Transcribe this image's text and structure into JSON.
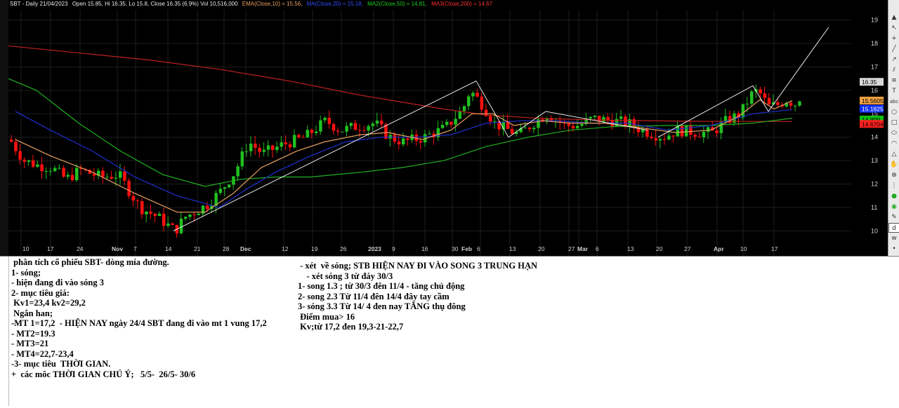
{
  "chart": {
    "symbol": "SBT - Daily 21/04/2023",
    "ohlc": "Open 15.85, Hi 16.35, Lo 15.8, Close 16.35 (6.9%) Vol 10,516,000",
    "indicators": [
      {
        "label": "EMA(Close,10) = 15.56,",
        "color": "#e8a060"
      },
      {
        "label": "MA(Close,20) = 15.18,",
        "color": "#3050ff"
      },
      {
        "label": "MA2(Close,50) = 14.81,",
        "color": "#20d020"
      },
      {
        "label": "MA3(Close,200) = 14.67",
        "color": "#ff3030"
      }
    ],
    "price_axis": [
      "19",
      "18",
      "17",
      "16",
      "15",
      "14",
      "13",
      "12",
      "11",
      "10"
    ],
    "price_tags": [
      {
        "label": "16.35",
        "value": 16.35,
        "bg": "#d8d8d8",
        "fg": "#000000"
      },
      {
        "label": "15.5605",
        "value": 15.56,
        "bg": "#f0a040",
        "fg": "#000000"
      },
      {
        "label": "15.1825",
        "value": 15.18,
        "bg": "#1030ff",
        "fg": "#ffffff"
      },
      {
        "label": "14.809",
        "value": 14.81,
        "bg": "#10c010",
        "fg": "#000000"
      },
      {
        "label": "14.6704",
        "value": 14.67,
        "bg": "#ff2020",
        "fg": "#000000"
      }
    ],
    "date_axis": [
      "10",
      "17",
      "24",
      "Nov",
      "7",
      "14",
      "21",
      "28",
      "Dec",
      "12",
      "19",
      "26",
      "2023",
      "9",
      "16",
      "30",
      "Feb",
      "6",
      "13",
      "20",
      "27",
      "Mar",
      "6",
      "13",
      "20",
      "27",
      "Apr",
      "10",
      "17"
    ],
    "colors": {
      "up": "#20c020",
      "down": "#ff1010",
      "ema10": "#e8a060",
      "ma20": "#2030d0",
      "ma50": "#20b020",
      "ma200": "#c02020",
      "trend": "#ffffff"
    }
  },
  "toolbar": {
    "icons": [
      "up-arrow-icon",
      "cursor-icon",
      "cross-icon",
      "line-icon",
      "ray-icon",
      "channel-icon",
      "fib-icon",
      "text-icon",
      "abc-icon",
      "circle-icon",
      "rect-icon",
      "ellipse-icon",
      "arc-icon",
      "triangle-icon",
      "hand-icon",
      "zoom-icon",
      "more-icon",
      "color-icon",
      "fill-icon",
      "pen-icon",
      "d-icon",
      "w-icon",
      "dot-icon"
    ]
  },
  "notes": {
    "left": [
      " phân tích cổ phiếu SBT- dòng mía đường.",
      "1- sóng;",
      "- hiện đang đi vào sóng 3",
      "2- mục tiêu giá:",
      " Kv1=23,4 kv2=29,2",
      " Ngắn han;",
      "-MT 1=17,2  - HIỆN NAY ngày 24/4 SBT đang đi vào mt 1 vung 17,2",
      "- MT2=19.3",
      "- MT3=21",
      "- MT4=22,7-23,4",
      "-3- mục tiêu  THỜI GIAN.",
      "+  các môc THỜI GIAN CHÚ Ý;   5/5-  26/5- 30/6"
    ],
    "right": [
      " - xét  về sóng; STB HIỆN NAY ĐI VÀO SONG 3 TRUNG HẠN",
      "    - xét sóng 3 từ đáy 30/3",
      "1- song 1.3 ; từ 30/3 đên 11/4 - tăng chủ động",
      "2- song 2.3 Từ 11/4 đên 14/4 đây tay cầm",
      "3- sóng 3.3 Từ 14/ 4 đen nay TĂNG thụ đông",
      " Điểm mua> 16",
      " Kv;từ 17,2 đen 19,3-21-22,7"
    ]
  }
}
